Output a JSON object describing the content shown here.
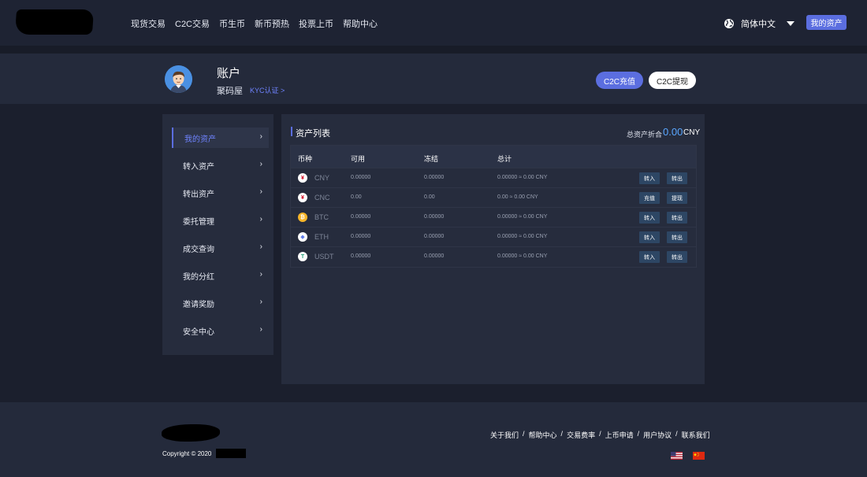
{
  "nav": {
    "links": [
      "现货交易",
      "C2C交易",
      "币生币",
      "新币预热",
      "投票上币",
      "帮助中心"
    ],
    "language": "简体中文",
    "my_assets": "我的资产"
  },
  "account": {
    "title": "账户",
    "username": "聚码屋",
    "kyc": "KYC认证 >",
    "c2c_recharge": "C2C充值",
    "c2c_withdraw": "C2C提现"
  },
  "sidebar": {
    "items": [
      {
        "label": "我的资产",
        "active": true
      },
      {
        "label": "转入资产"
      },
      {
        "label": "转出资产"
      },
      {
        "label": "委托管理"
      },
      {
        "label": "成交查询"
      },
      {
        "label": "我的分红"
      },
      {
        "label": "邀请奖励"
      },
      {
        "label": "安全中心"
      }
    ],
    "chevron": "›"
  },
  "assets": {
    "title": "资产列表",
    "total_label": "总资产折合",
    "total_value": "0.00",
    "total_unit": "CNY",
    "headers": [
      "币种",
      "可用",
      "冻结",
      "总计"
    ],
    "rows": [
      {
        "coin": "CNY",
        "available": "0.00000",
        "frozen": "0.00000",
        "total": "0.00000 ≈ 0.00 CNY",
        "actions": [
          "转入",
          "转出"
        ]
      },
      {
        "coin": "CNC",
        "available": "0.00",
        "frozen": "0.00",
        "total": "0.00 ≈ 0.00 CNY",
        "actions": [
          "充值",
          "提现"
        ]
      },
      {
        "coin": "BTC",
        "available": "0.00000",
        "frozen": "0.00000",
        "total": "0.00000 ≈ 0.00 CNY",
        "actions": [
          "转入",
          "转出"
        ]
      },
      {
        "coin": "ETH",
        "available": "0.00000",
        "frozen": "0.00000",
        "total": "0.00000 ≈ 0.00 CNY",
        "actions": [
          "转入",
          "转出"
        ]
      },
      {
        "coin": "USDT",
        "available": "0.00000",
        "frozen": "0.00000",
        "total": "0.00000 ≈ 0.00 CNY",
        "actions": [
          "转入",
          "转出"
        ]
      }
    ],
    "coin_icons": [
      {
        "glyph": "¥",
        "bg": "#ffffff",
        "fg": "#d0021b"
      },
      {
        "glyph": "¥",
        "bg": "#ffffff",
        "fg": "#d0021b"
      },
      {
        "glyph": "₿",
        "bg": "#f7b529",
        "fg": "#ffffff"
      },
      {
        "glyph": "◆",
        "bg": "#ffffff",
        "fg": "#627eea"
      },
      {
        "glyph": "T",
        "bg": "#ffffff",
        "fg": "#26a17b"
      }
    ]
  },
  "footer": {
    "copyright": "Copyright © 2020",
    "links": [
      "关于我们",
      "帮助中心",
      "交易费率",
      "上币申请",
      "用户协议",
      "联系我们"
    ],
    "separator": "/"
  },
  "colors": {
    "accent": "#5b6ee0",
    "link": "#6f83ff",
    "total_value": "#5aa7ff",
    "action_button": "#2d4664"
  }
}
